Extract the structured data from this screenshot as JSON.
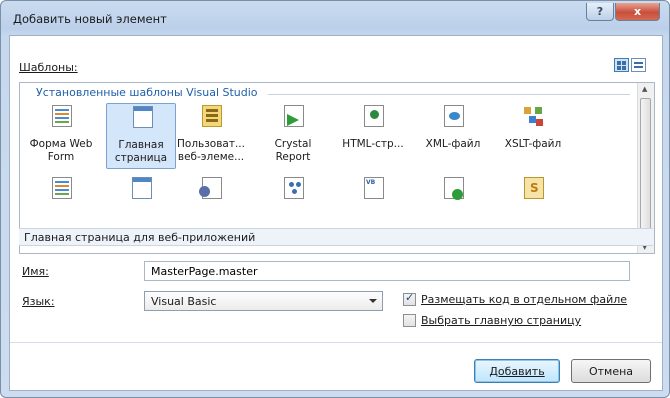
{
  "window": {
    "title": "Добавить новый элемент",
    "help_glyph": "?",
    "close_glyph": "x"
  },
  "templates_label": "Шаблоны:",
  "group_header": "Установленные шаблоны Visual Studio",
  "row1": [
    {
      "line1": "Форма Web",
      "line2": "Form",
      "icon": "web-form-icon"
    },
    {
      "line1": "Главная",
      "line2": "страница",
      "icon": "master-page-icon"
    },
    {
      "line1": "Пользоват...",
      "line2": "веб-элеме...",
      "icon": "user-control-icon"
    },
    {
      "line1": "Crystal",
      "line2": "Report",
      "icon": "crystal-report-icon"
    },
    {
      "line1": "HTML-стр...",
      "line2": "",
      "icon": "html-page-icon"
    },
    {
      "line1": "XML-файл",
      "line2": "",
      "icon": "xml-file-icon"
    },
    {
      "line1": "XSLT-файл",
      "line2": "",
      "icon": "xslt-file-icon"
    }
  ],
  "row2_icons": [
    "web-form-icon",
    "master-page-icon",
    "class-gear-icon",
    "people-icon",
    "vb-file-icon",
    "xml-schema-icon",
    "skin-file-icon"
  ],
  "description": "Главная страница для веб-приложений",
  "name_label": "Имя:",
  "name_value": "MasterPage.master",
  "language_label": "Язык:",
  "language_value": "Visual Basic",
  "checkbox_separate": {
    "label": "Размещать код в отдельном файле",
    "checked": true
  },
  "checkbox_master": {
    "label": "Выбрать главную страницу",
    "checked": false
  },
  "add_button": "Добавить",
  "cancel_button": "Отмена"
}
